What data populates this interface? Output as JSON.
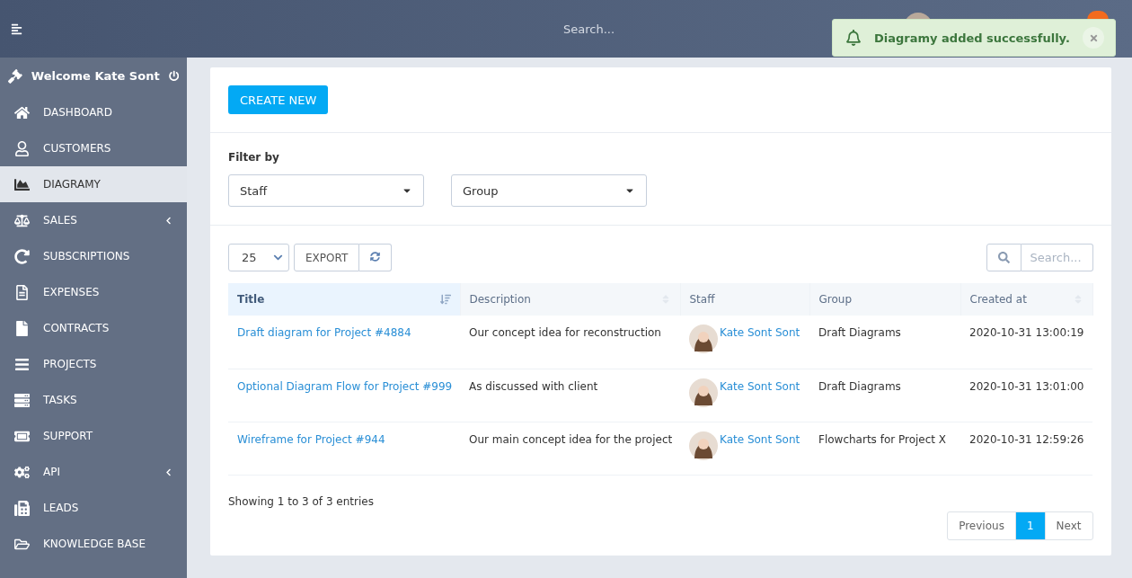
{
  "header": {
    "search": {
      "placeholder": "Search..."
    }
  },
  "toast": {
    "message": "Diagramy added successfully."
  },
  "sidebar": {
    "welcome": "Welcome Kate Sont",
    "items": [
      {
        "label": "DASHBOARD",
        "selected": false,
        "has_submenu": false
      },
      {
        "label": "CUSTOMERS",
        "selected": false,
        "has_submenu": false
      },
      {
        "label": "DIAGRAMY",
        "selected": true,
        "has_submenu": false
      },
      {
        "label": "SALES",
        "selected": false,
        "has_submenu": true
      },
      {
        "label": "SUBSCRIPTIONS",
        "selected": false,
        "has_submenu": false
      },
      {
        "label": "EXPENSES",
        "selected": false,
        "has_submenu": false
      },
      {
        "label": "CONTRACTS",
        "selected": false,
        "has_submenu": false
      },
      {
        "label": "PROJECTS",
        "selected": false,
        "has_submenu": false
      },
      {
        "label": "TASKS",
        "selected": false,
        "has_submenu": false
      },
      {
        "label": "SUPPORT",
        "selected": false,
        "has_submenu": false
      },
      {
        "label": "API",
        "selected": false,
        "has_submenu": true
      },
      {
        "label": "LEADS",
        "selected": false,
        "has_submenu": false
      },
      {
        "label": "KNOWLEDGE BASE",
        "selected": false,
        "has_submenu": false
      }
    ]
  },
  "create_button": "CREATE NEW",
  "filter": {
    "label": "Filter by",
    "selects": [
      {
        "value": "Staff"
      },
      {
        "value": "Group"
      }
    ]
  },
  "toolbar": {
    "page_length": "25",
    "export": "EXPORT",
    "search": {
      "placeholder": "Search..."
    }
  },
  "table": {
    "columns": [
      {
        "label": "Title",
        "sortable": true,
        "sorted": true
      },
      {
        "label": "Description",
        "sortable": true,
        "sorted": false
      },
      {
        "label": "Staff",
        "sortable": false,
        "sorted": false
      },
      {
        "label": "Group",
        "sortable": false,
        "sorted": false
      },
      {
        "label": "Created at",
        "sortable": true,
        "sorted": false
      }
    ],
    "rows": [
      {
        "title": "Draft diagram for Project #4884",
        "description": "Our concept idea for reconstruction",
        "staff": "Kate Sont Sont",
        "group": "Draft Diagrams",
        "created": "2020-10-31 13:00:19"
      },
      {
        "title": "Optional Diagram Flow for Project #999",
        "description": "As discussed with client",
        "staff": "Kate Sont Sont",
        "group": "Draft Diagrams",
        "created": "2020-10-31 13:01:00"
      },
      {
        "title": "Wireframe for Project #944",
        "description": "Our main concept idea for the project",
        "staff": "Kate Sont Sont",
        "group": "Flowcharts for Project X",
        "created": "2020-10-31 12:59:26"
      }
    ]
  },
  "info": "Showing 1 to 3 of 3 entries",
  "pagination": {
    "previous": "Previous",
    "pages": [
      {
        "label": "1",
        "selected": true
      }
    ],
    "next": "Next"
  }
}
